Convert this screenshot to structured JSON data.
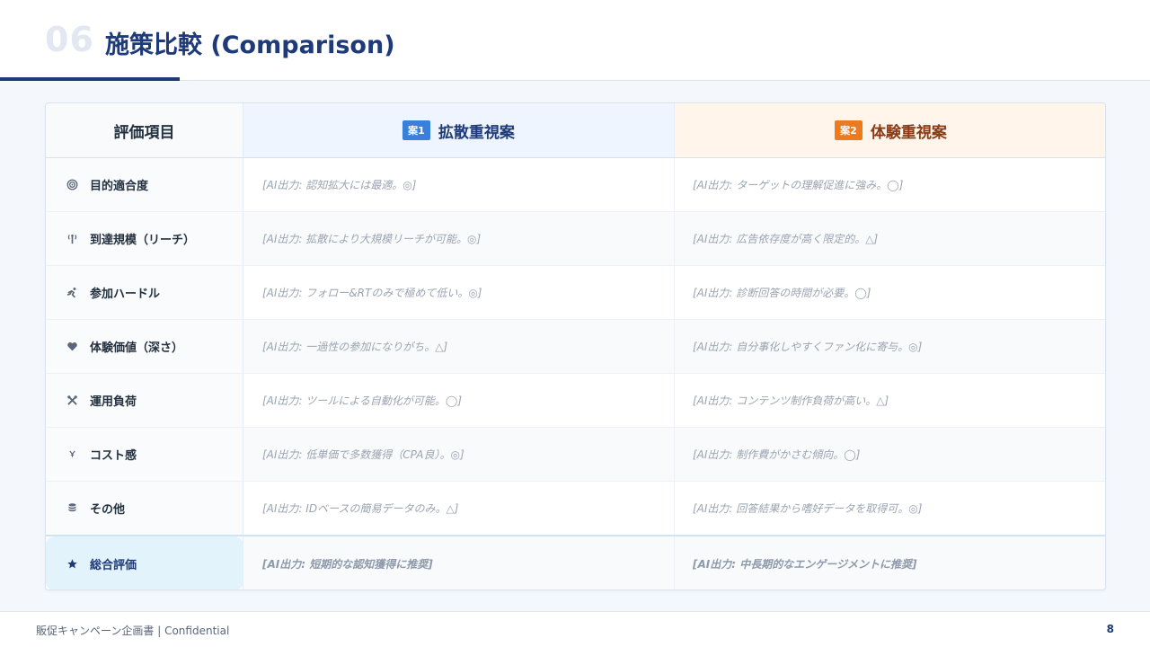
{
  "header": {
    "section_number": "06",
    "title": "施策比較 (Comparison)"
  },
  "table": {
    "label_header": "評価項目",
    "plans": [
      {
        "badge": "案1",
        "title": "拡散重視案",
        "color": "#3a7fd9"
      },
      {
        "badge": "案2",
        "title": "体験重視案",
        "color": "#ec7a1f"
      }
    ],
    "rows": [
      {
        "icon": "target-icon",
        "label": "目的適合度",
        "plan1": "[AI出力: 認知拡大には最適。◎]",
        "plan2": "[AI出力: ターゲットの理解促進に強み。◯]"
      },
      {
        "icon": "broadcast-tower-icon",
        "label": "到達規模（リーチ）",
        "plan1": "[AI出力: 拡散により大規模リーチが可能。◎]",
        "plan2": "[AI出力: 広告依存度が高く限定的。△]"
      },
      {
        "icon": "running-person-icon",
        "label": "参加ハードル",
        "plan1": "[AI出力: フォロー&RTのみで極めて低い。◎]",
        "plan2": "[AI出力: 診断回答の時間が必要。◯]"
      },
      {
        "icon": "heart-icon",
        "label": "体験価値（深さ）",
        "plan1": "[AI出力: 一過性の参加になりがち。△]",
        "plan2": "[AI出力: 自分事化しやすくファン化に寄与。◎]"
      },
      {
        "icon": "tools-icon",
        "label": "運用負荷",
        "plan1": "[AI出力: ツールによる自動化が可能。◯]",
        "plan2": "[AI出力: コンテンツ制作負荷が高い。△]"
      },
      {
        "icon": "yen-icon",
        "label": "コスト感",
        "plan1": "[AI出力: 低単価で多数獲得（CPA良）。◎]",
        "plan2": "[AI出力: 制作費がかさむ傾向。◯]"
      },
      {
        "icon": "database-icon",
        "label": "その他",
        "plan1": "[AI出力: IDベースの簡易データのみ。△]",
        "plan2": "[AI出力: 回答結果から嗜好データを取得可。◎]"
      }
    ],
    "total": {
      "icon": "star-icon",
      "label": "総合評価",
      "plan1": "[AI出力: 短期的な認知獲得に推奨]",
      "plan2": "[AI出力: 中長期的なエンゲージメントに推奨]"
    }
  },
  "footer": {
    "doc_label": "販促キャンペーン企画書 | Confidential",
    "page_number": "8"
  },
  "colors": {
    "primary": "#1e3a78",
    "plan1_accent": "#3a7fd9",
    "plan2_accent": "#ec7a1f",
    "total_highlight": "#e3f3fc"
  }
}
